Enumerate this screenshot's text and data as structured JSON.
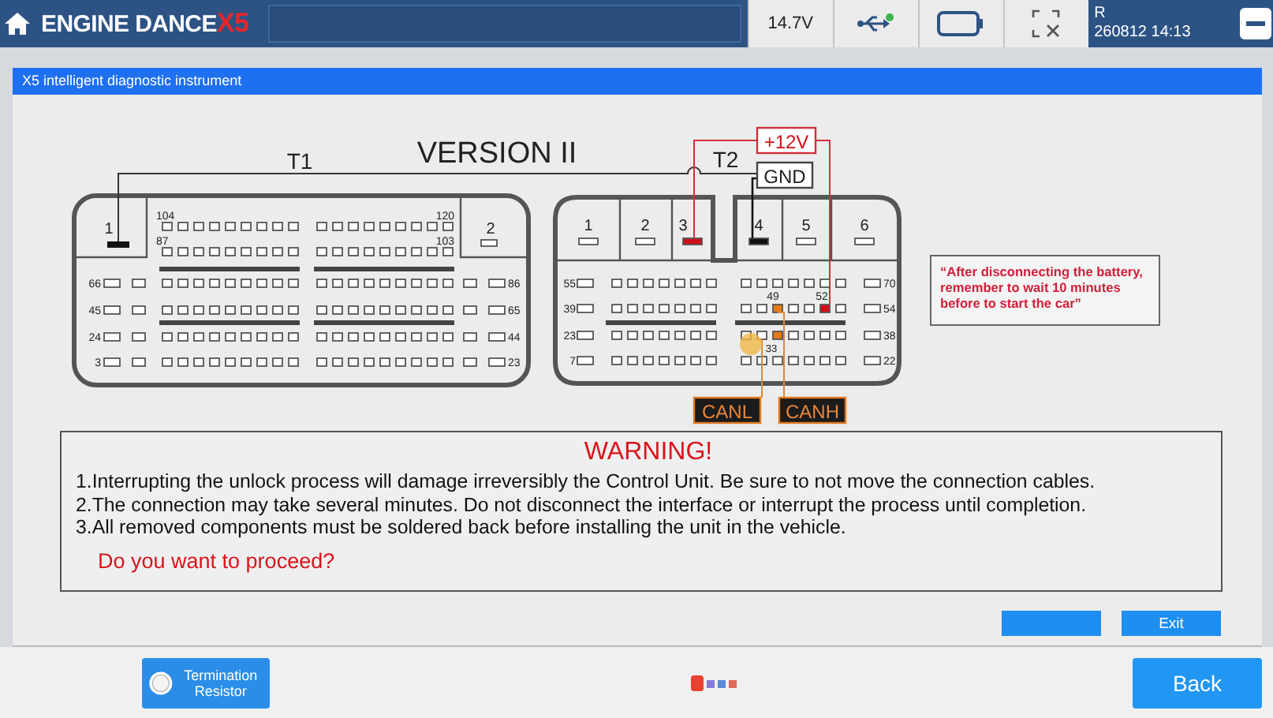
{
  "header": {
    "brand": "ENGINE DANCE",
    "brand_suffix": "X5",
    "voltage": "14.7V",
    "user": "R",
    "datetime": "260812 14:13"
  },
  "panel": {
    "title": "X5 intelligent diagnostic instrument"
  },
  "diagram": {
    "title": "VERSION II",
    "t1": {
      "label": "T1",
      "pin_labels": [
        "1",
        "2",
        "104",
        "120",
        "87",
        "103",
        "66",
        "45",
        "24",
        "3",
        "86",
        "65",
        "44",
        "23"
      ]
    },
    "t2": {
      "label": "T2",
      "pin_labels": [
        "1",
        "2",
        "3",
        "4",
        "5",
        "6",
        "55",
        "39",
        "23",
        "7",
        "70",
        "54",
        "38",
        "22",
        "49",
        "52",
        "33"
      ]
    },
    "power": [
      "+12V",
      "GND"
    ],
    "can": [
      "CANL",
      "CANH"
    ],
    "note": [
      "“After disconnecting the battery,",
      "remember to wait 10 minutes",
      "before to start the car”"
    ]
  },
  "warning": {
    "title": "WARNING!",
    "items": [
      "1.Interrupting the unlock process will damage irreversibly the Control Unit. Be sure to not move the connection cables.",
      "2.The connection may take several minutes. Do not disconnect the interface or interrupt the process until completion.",
      "3.All removed components must be soldered back before installing the unit in the vehicle."
    ],
    "question": "Do you want to proceed?"
  },
  "dialog_buttons": [
    {
      "kind": "blank"
    },
    {
      "kind": "text",
      "label": "Exit"
    }
  ],
  "footer": {
    "termination": {
      "label": "Termination Resistor",
      "on": false
    },
    "back": "Back"
  }
}
